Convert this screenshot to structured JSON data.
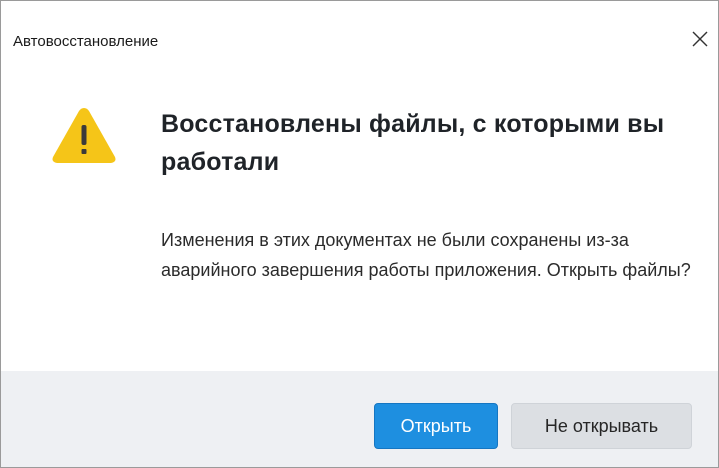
{
  "window": {
    "title": "Автовосстановление",
    "close_icon": "close-icon"
  },
  "content": {
    "icon": "warning-icon",
    "heading": "Восстановлены файлы, с которыми вы работали",
    "message": "Изменения в этих документах не были сохранены из-за аварийного завершения работы приложения. Открыть файлы?"
  },
  "buttons": {
    "open_label": "Открыть",
    "dont_open_label": "Не открывать"
  },
  "colors": {
    "primary_button": "#1e8fe0",
    "secondary_button": "#dcdfe3",
    "warning_icon": "#f5c518",
    "footer_bg": "#eef0f3"
  }
}
